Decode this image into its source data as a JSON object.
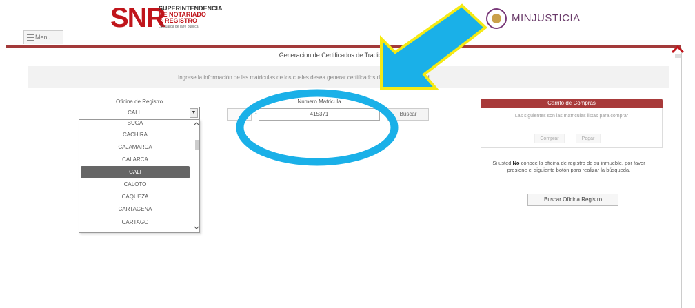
{
  "header": {
    "snr_logo": "SNR",
    "snr_line1": "SUPERINTENDENCIA",
    "snr_line2": "DE NOTARIADO",
    "snr_line3": "& REGISTRO",
    "snr_tagline": "La guarda de la fe pública",
    "minjusticia": "MINJUSTICIA",
    "menu_label": "Menu"
  },
  "page": {
    "title": "Generacion de Certificados de Tradicion",
    "info_text": "Ingrese la información de las matriculas de los cuales desea generar certificados de tradicion y libertad."
  },
  "form": {
    "oficina_label": "Oficina de Registro",
    "oficina_value": "CALI",
    "matricula_label": "Numero Matricula",
    "matricula_value": "415371",
    "buscar_label": "Buscar"
  },
  "dropdown": {
    "options": [
      "BUGA",
      "CACHIRA",
      "CAJAMARCA",
      "CALARCA",
      "CALI",
      "CALOTO",
      "CAQUEZA",
      "CARTAGENA",
      "CARTAGO"
    ],
    "selected": "CALI"
  },
  "cart": {
    "title": "Carrito de Compras",
    "text": "Las siguientes son las matriculas listas para comprar",
    "btn_comprar": "Comprar",
    "btn_pagar": "Pagar"
  },
  "help": {
    "pre": "Si usted ",
    "bold": "No",
    "post": " conoce la oficina de registro de su inmueble, por favor presione el siguiente botón para realizar la búsqueda.",
    "button": "Buscar Oficina Registro"
  },
  "annotation": {
    "arrow_color": "#1ab0e8",
    "arrow_outline": "#f5ea14",
    "circle_color": "#1ab0e8"
  }
}
